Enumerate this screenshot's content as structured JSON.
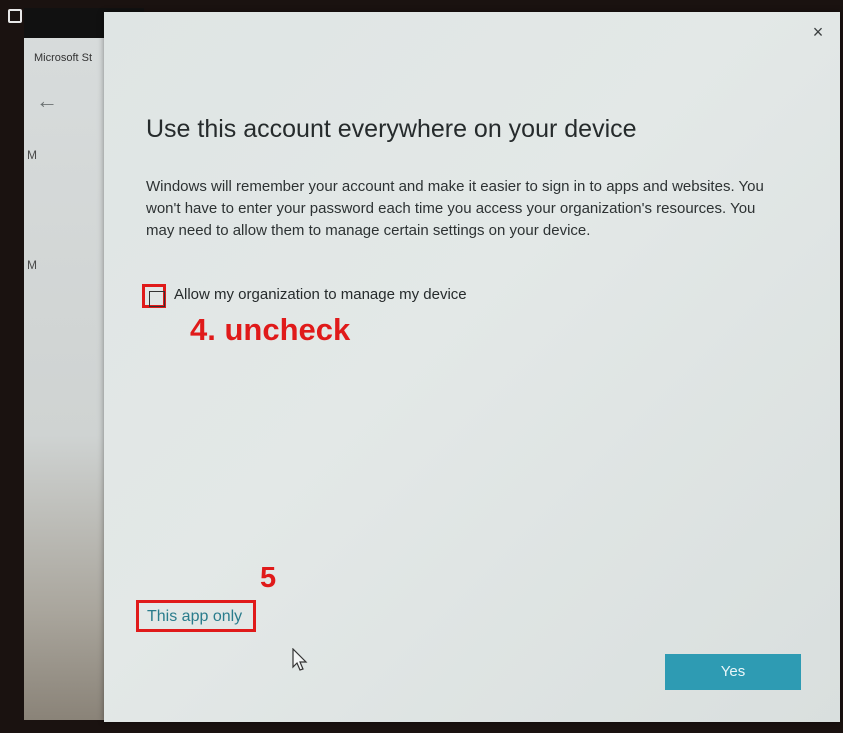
{
  "background_window": {
    "title": "Microsoft St",
    "back_icon": "arrow-left-icon",
    "side_letters": [
      "M",
      "M"
    ]
  },
  "dialog": {
    "close_label": "×",
    "title": "Use this account everywhere on your device",
    "description": "Windows will remember your account and make it easier to sign in to apps and websites. You won't have to enter your password each time you access your organization's resources. You may need to allow them to manage certain settings on your device.",
    "checkbox": {
      "label": "Allow my organization to manage my device",
      "checked": false
    },
    "link_label": "This app only",
    "yes_label": "Yes"
  },
  "annotations": {
    "step4": "4. uncheck",
    "step5": "5"
  },
  "colors": {
    "annotation": "#e01a1a",
    "accent": "#2e9bb3",
    "link": "#2a7c8c"
  }
}
